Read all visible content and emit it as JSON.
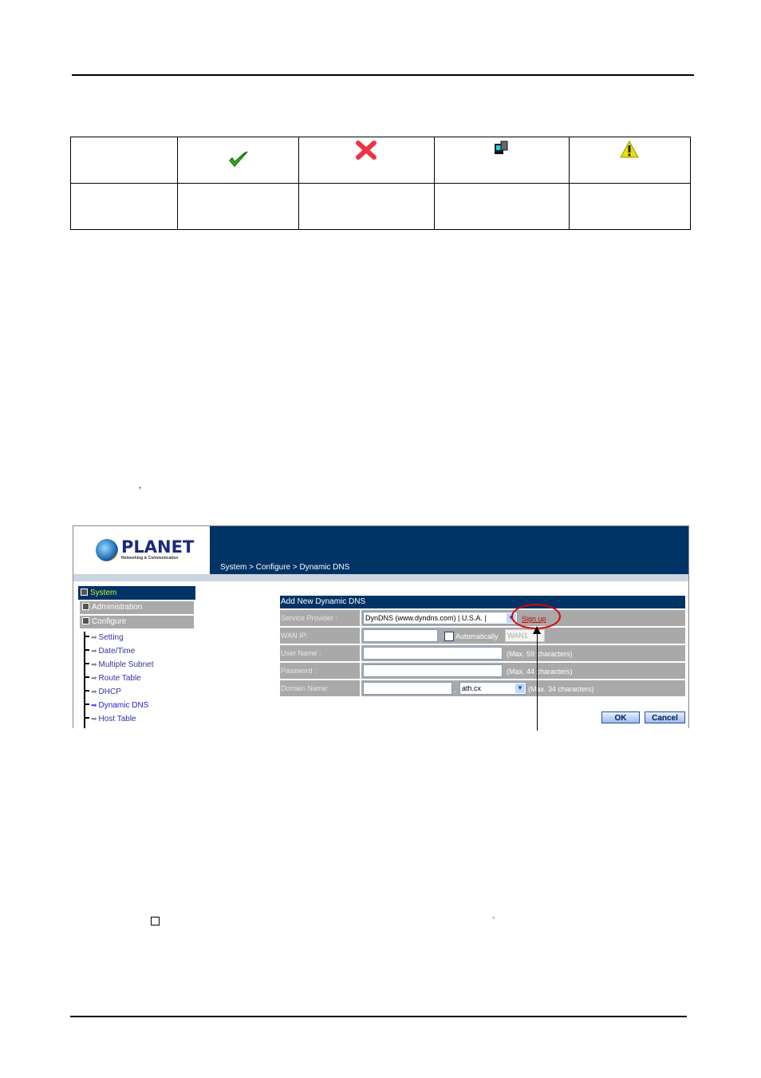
{
  "document": {
    "punctuation_comma": ",",
    "degree_mark": "°"
  },
  "icon_table": {
    "header_row": [
      {
        "text": "",
        "icon": null
      },
      {
        "text": "",
        "icon": "green-check-icon"
      },
      {
        "text": "",
        "icon": "red-x-icon"
      },
      {
        "text": "",
        "icon": "computer-icon"
      },
      {
        "text": "",
        "icon": "warning-icon"
      }
    ],
    "body_row": [
      "",
      "",
      "",
      "",
      ""
    ]
  },
  "screenshot": {
    "logo": {
      "name": "PLANET",
      "tagline": "Networking & Communication"
    },
    "breadcrumb": "System > Configure > Dynamic DNS",
    "sidebar": {
      "system": "System",
      "groups": [
        "Administration",
        "Configure"
      ],
      "items": [
        {
          "label": "Setting",
          "active": false
        },
        {
          "label": "Date/Time",
          "active": false
        },
        {
          "label": "Multiple Subnet",
          "active": false
        },
        {
          "label": "Route Table",
          "active": false
        },
        {
          "label": "DHCP",
          "active": false
        },
        {
          "label": "Dynamic DNS",
          "active": true
        },
        {
          "label": "Host Table",
          "active": false
        }
      ]
    },
    "form": {
      "title": "Add New Dynamic DNS",
      "service_provider": {
        "label": "Service Provider :",
        "value": "DynDNS (www.dyndns.com) | U.S.A. |",
        "signup": "Sign up"
      },
      "wan_ip": {
        "label": "WAN IP:",
        "value": "",
        "auto_label": "Automatically",
        "auto_checked": false,
        "wan_select": "WAN1"
      },
      "user_name": {
        "label": "User Name :",
        "value": "",
        "hint": "(Max. 59 characters)"
      },
      "password": {
        "label": "Password :",
        "value": "",
        "hint": "(Max. 44 characters)"
      },
      "domain_name": {
        "label": "Domain Name:",
        "value": "",
        "separator": ".",
        "suffix": "ath.cx",
        "hint": "(Max. 34 characters)"
      },
      "ok": "OK",
      "cancel": "Cancel"
    }
  }
}
